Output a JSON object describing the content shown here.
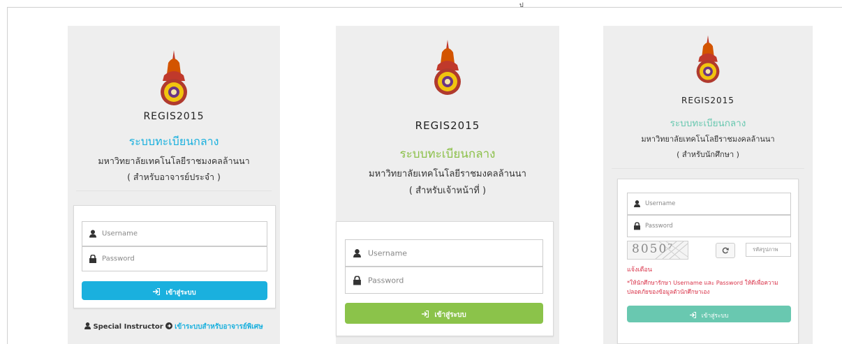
{
  "page": {
    "top_mark": "ป"
  },
  "colors": {
    "panel_bg": "#eeeeee",
    "blue": "#1ab0de",
    "green_title": "#8cc04a",
    "green_btn": "#8bc34a",
    "teal": "#69c8b0",
    "warning_red": "#d9344a"
  },
  "panels": [
    {
      "app_name": "REGIS2015",
      "title": "ระบบทะเบียนกลาง",
      "university": "มหาวิทยาลัยเทคโนโลยีราชมงคลล้านนา",
      "role": "( สำหรับอาจารย์ประจำ )",
      "username_placeholder": "Username",
      "password_placeholder": "Password",
      "login_label": "เข้าสู่ระบบ",
      "special_label": "Special Instructor",
      "special_link": "เข้าระบบสำหรับอาจารย์พิเศษ"
    },
    {
      "app_name": "REGIS2015",
      "title": "ระบบทะเบียนกลาง",
      "university": "มหาวิทยาลัยเทคโนโลยีราชมงคลล้านนา",
      "role": "( สำหรับเจ้าหน้าที่ )",
      "username_placeholder": "Username",
      "password_placeholder": "Password",
      "login_label": "เข้าสู่ระบบ"
    },
    {
      "app_name": "REGIS2015",
      "title": "ระบบทะเบียนกลาง",
      "university": "มหาวิทยาลัยเทคโนโลยีราชมงคลล้านนา",
      "role": "( สำหรับนักศึกษา )",
      "username_placeholder": "Username",
      "password_placeholder": "Password",
      "captcha_digits": "8050⁷",
      "captcha_placeholder": "รหัสรูปภาพ",
      "warning_title": "แจ้งเตือน",
      "warning_text": "*ให้นักศึกษารักษา Username และ Password ให้ดีเพื่อความปลอดภัยของข้อมูลตัวนักศึกษาเอง",
      "login_label": "เข้าสู่ระบบ"
    }
  ]
}
